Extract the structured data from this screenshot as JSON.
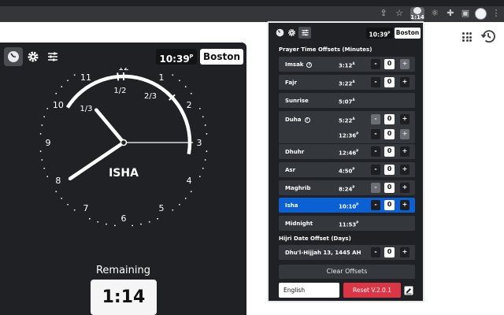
{
  "browser": {
    "extension_badge": "1:14",
    "icons": [
      "share-icon",
      "star-icon",
      "prayer-times-extension-icon",
      "react-devtools-icon",
      "puzzle-icon",
      "side-panel-icon",
      "profile-avatar",
      "menu-icon"
    ]
  },
  "page": {
    "icons": [
      "apps-grid-icon",
      "history-icon"
    ]
  },
  "panel": {
    "time": "10:39",
    "time_suffix": "P",
    "city": "Boston",
    "clock": {
      "prayer": "ISHA",
      "numbers": [
        "12",
        "1",
        "2",
        "3",
        "4",
        "5",
        "6",
        "7",
        "8",
        "9",
        "10",
        "11"
      ],
      "arc_labels": [
        "1/3",
        "1/2",
        "2/3"
      ]
    },
    "remaining_label": "Remaining",
    "remaining_value": "1:14"
  },
  "popup": {
    "time": "10:39",
    "time_suffix": "P",
    "city": "Boston",
    "offsets_title": "Prayer Time Offsets (Minutes)",
    "hijri_title": "Hijri Date Offset (Days)",
    "rows": {
      "imsak": {
        "name": "Imsak",
        "time": "3:12",
        "suffix": "A",
        "offset": "0"
      },
      "fajr": {
        "name": "Fajr",
        "time": "3:22",
        "suffix": "A",
        "offset": "0"
      },
      "sunrise": {
        "name": "Sunrise",
        "time": "5:07",
        "suffix": "A"
      },
      "duha": {
        "name": "Duha",
        "time": "5:22",
        "suffix": "A",
        "offset": "0",
        "time2": "12:36",
        "suffix2": "P",
        "offset2": "0"
      },
      "dhuhr": {
        "name": "Dhuhr",
        "time": "12:46",
        "suffix": "P",
        "offset": "0"
      },
      "asr": {
        "name": "Asr",
        "time": "4:50",
        "suffix": "P",
        "offset": "0"
      },
      "maghrib": {
        "name": "Maghrib",
        "time": "8:24",
        "suffix": "P",
        "offset": "0"
      },
      "isha": {
        "name": "Isha",
        "time": "10:10",
        "suffix": "P",
        "offset": "0"
      },
      "midnight": {
        "name": "Midnight",
        "time": "11:53",
        "suffix": "P"
      }
    },
    "hijri": {
      "date": "Dhu'l-Hijjah 13, 1445 AH",
      "offset": "0"
    },
    "minus": "-",
    "plus": "+",
    "info": "i",
    "clear_label": "Clear Offsets",
    "language": "English",
    "reset_label": "Reset V.2.0.1"
  },
  "colors": {
    "highlight": "#0b61d3",
    "reset": "#dc3545",
    "panel": "#202124"
  }
}
